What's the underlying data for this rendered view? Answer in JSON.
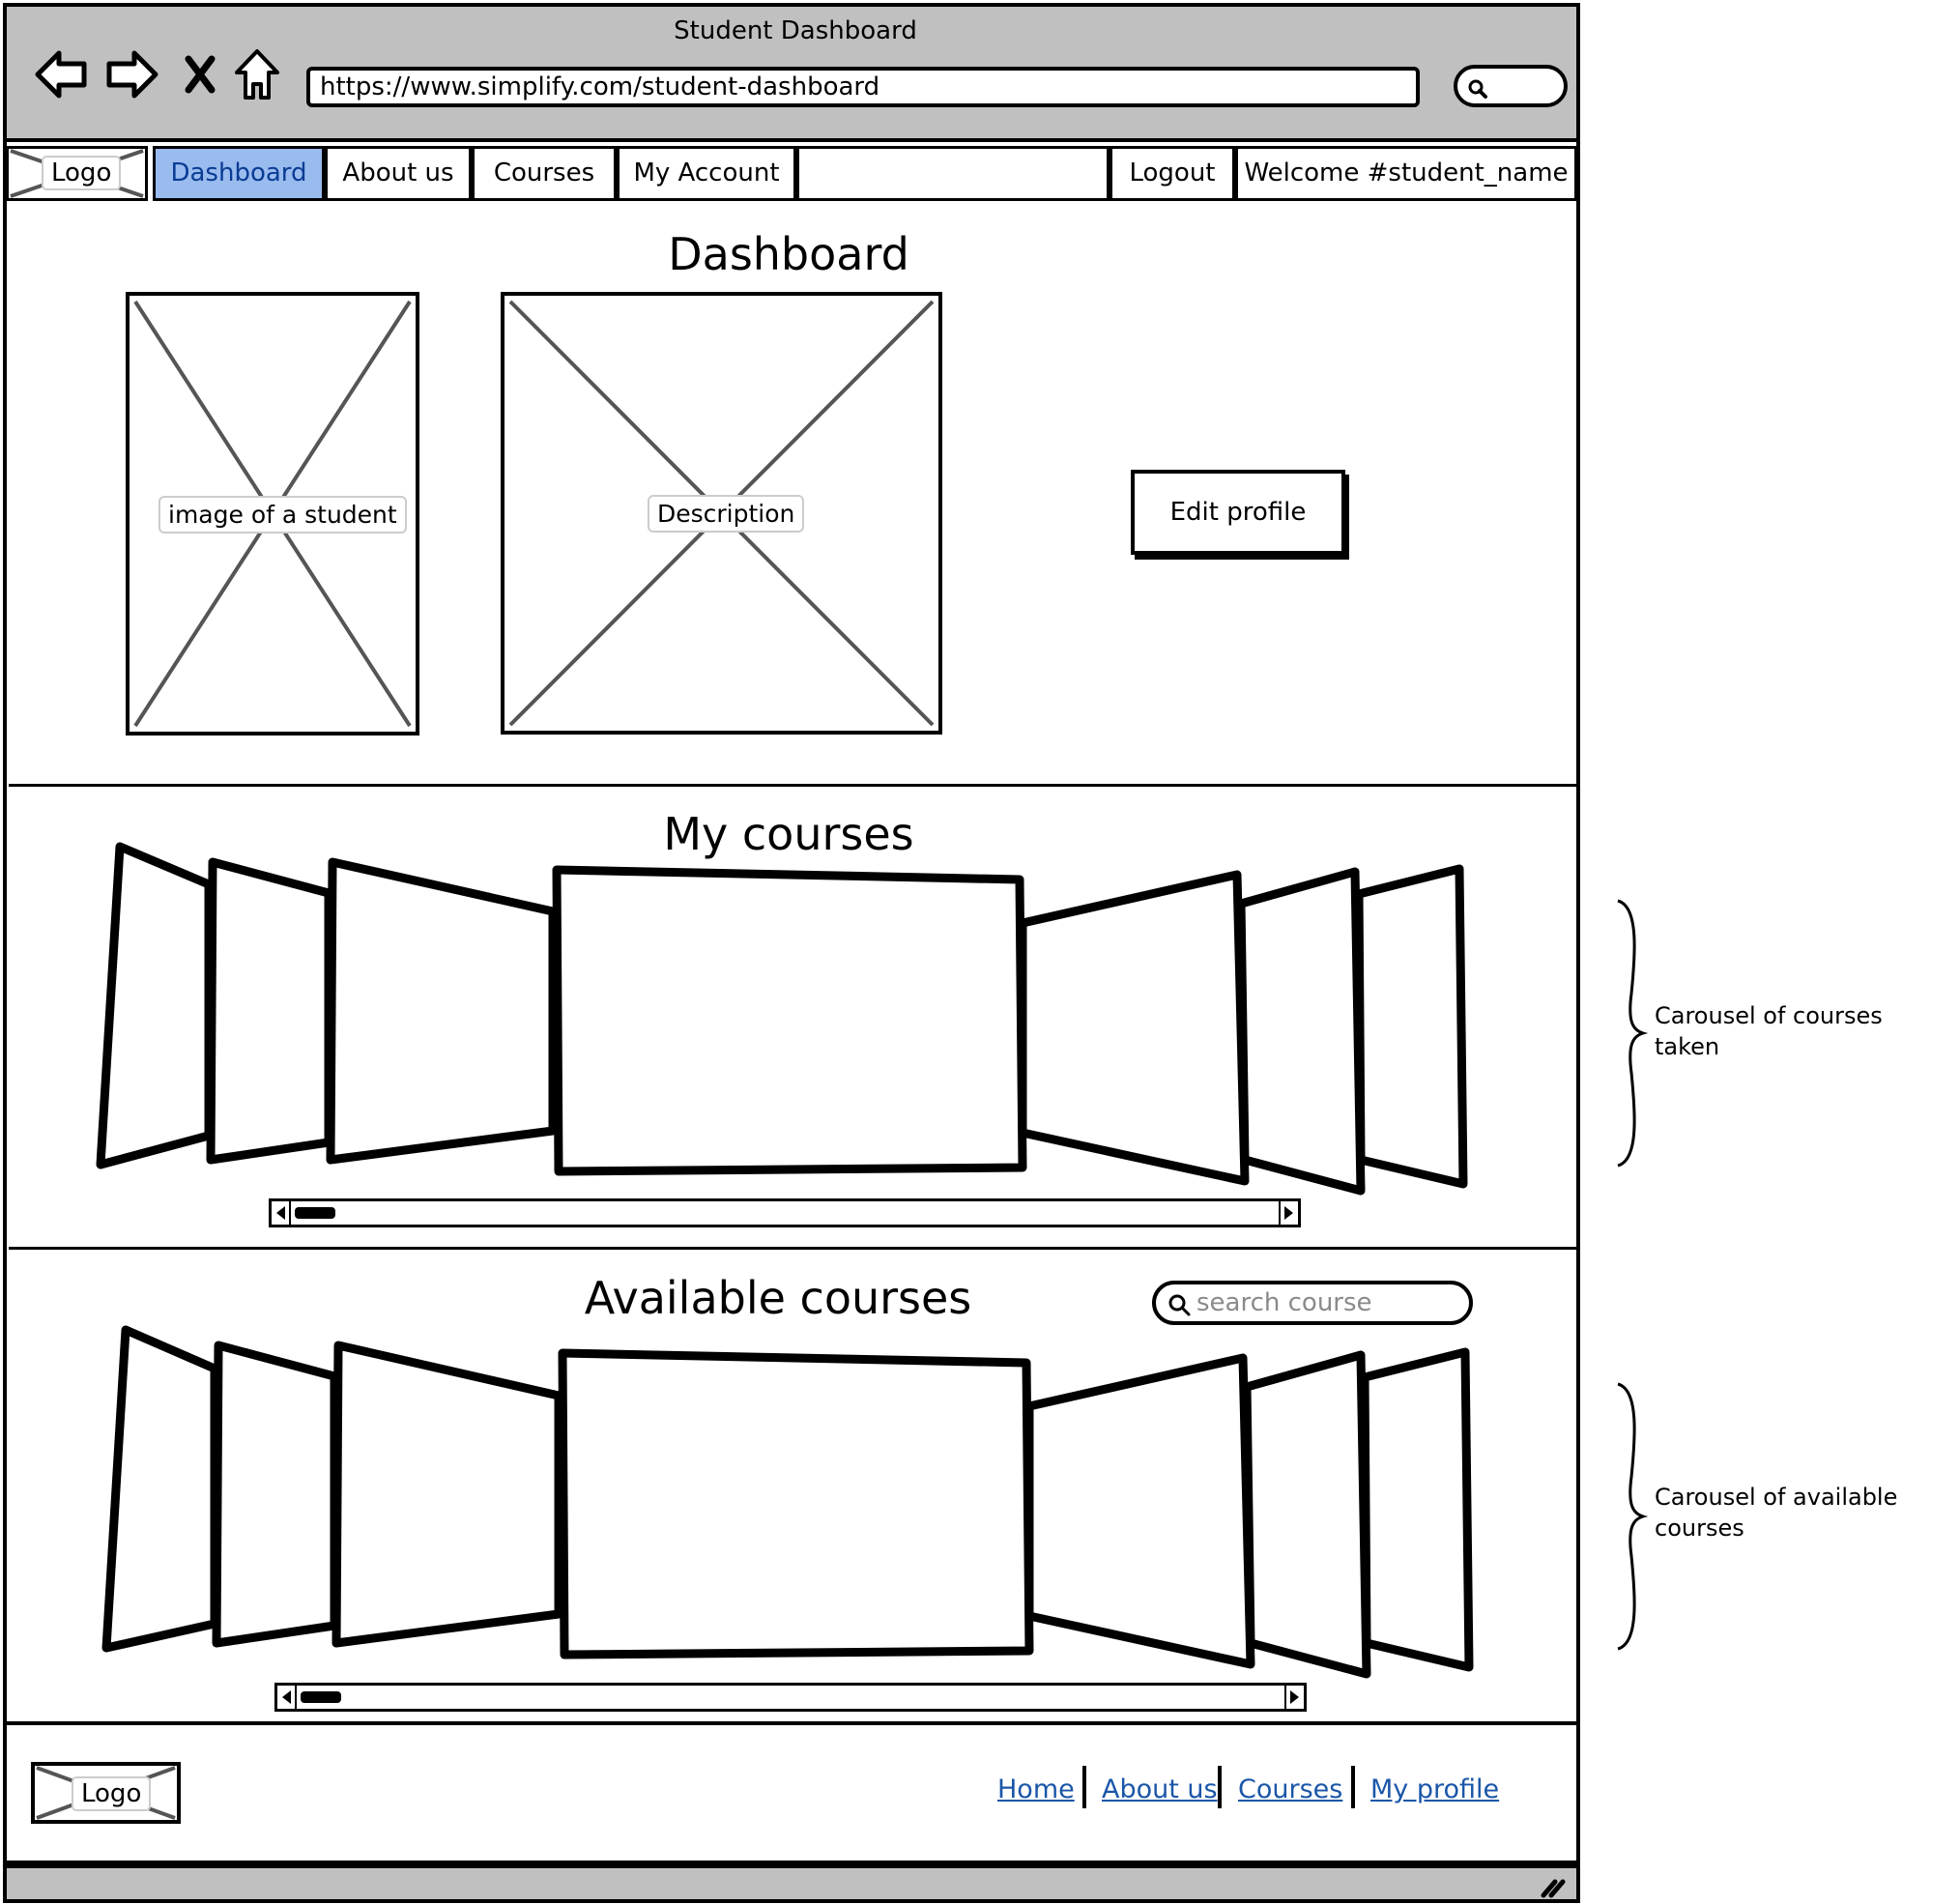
{
  "browser": {
    "title": "Student Dashboard",
    "url": "https://www.simplify.com/student-dashboard"
  },
  "nav": {
    "logo": "Logo",
    "items": [
      "Dashboard",
      "About us",
      "Courses",
      "My Account"
    ],
    "active": "Dashboard",
    "logout": "Logout",
    "welcome": "Welcome #student_name"
  },
  "dashboard": {
    "title": "Dashboard",
    "student_image_label": "image of a student",
    "description_label": "Description",
    "edit_profile": "Edit profile"
  },
  "my_courses": {
    "title": "My courses"
  },
  "available_courses": {
    "title": "Available courses",
    "search_placeholder": "search course"
  },
  "footer": {
    "logo": "Logo",
    "links": [
      "Home",
      "About us",
      "Courses",
      "My profile"
    ]
  },
  "annotations": {
    "my_courses_note": "Carousel of courses\ntaken",
    "available_courses_note": "Carousel of available\ncourses"
  },
  "colors": {
    "chrome": "#c0c0c0",
    "active_tab": "#99bbee",
    "link": "#1a56a8"
  }
}
